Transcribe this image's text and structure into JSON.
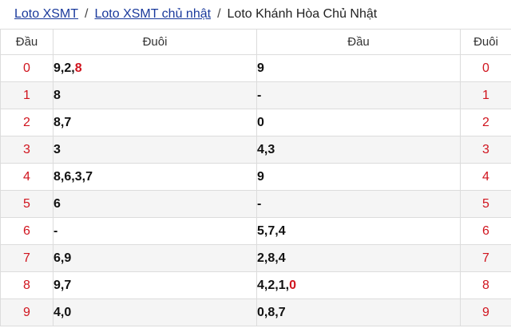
{
  "breadcrumb": {
    "link1": "Loto XSMT",
    "link2": "Loto XSMT chủ nhật",
    "current": "Loto Khánh Hòa Chủ Nhật",
    "separator": "/"
  },
  "table": {
    "headers": [
      "Đầu",
      "Đuôi",
      "Đầu",
      "Đuôi"
    ],
    "rows": [
      {
        "head": "0",
        "duoi": [
          "9",
          "2",
          "8"
        ],
        "duoi_highlight": [
          2
        ],
        "dau": [
          "9"
        ],
        "dau_highlight": []
      },
      {
        "head": "1",
        "duoi": [
          "8"
        ],
        "duoi_highlight": [],
        "dau": [
          "-"
        ],
        "dau_highlight": []
      },
      {
        "head": "2",
        "duoi": [
          "8",
          "7"
        ],
        "duoi_highlight": [],
        "dau": [
          "0"
        ],
        "dau_highlight": []
      },
      {
        "head": "3",
        "duoi": [
          "3"
        ],
        "duoi_highlight": [],
        "dau": [
          "4",
          "3"
        ],
        "dau_highlight": []
      },
      {
        "head": "4",
        "duoi": [
          "8",
          "6",
          "3",
          "7"
        ],
        "duoi_highlight": [],
        "dau": [
          "9"
        ],
        "dau_highlight": []
      },
      {
        "head": "5",
        "duoi": [
          "6"
        ],
        "duoi_highlight": [],
        "dau": [
          "-"
        ],
        "dau_highlight": []
      },
      {
        "head": "6",
        "duoi": [
          "-"
        ],
        "duoi_highlight": [],
        "dau": [
          "5",
          "7",
          "4"
        ],
        "dau_highlight": []
      },
      {
        "head": "7",
        "duoi": [
          "6",
          "9"
        ],
        "duoi_highlight": [],
        "dau": [
          "2",
          "8",
          "4"
        ],
        "dau_highlight": []
      },
      {
        "head": "8",
        "duoi": [
          "9",
          "7"
        ],
        "duoi_highlight": [],
        "dau": [
          "4",
          "2",
          "1",
          "0"
        ],
        "dau_highlight": [
          3
        ]
      },
      {
        "head": "9",
        "duoi": [
          "4",
          "0"
        ],
        "duoi_highlight": [],
        "dau": [
          "0",
          "8",
          "7"
        ],
        "dau_highlight": []
      }
    ]
  },
  "colors": {
    "highlight": "#d0141e",
    "link": "#1a3a9c",
    "alt_row": "#f5f5f5"
  }
}
